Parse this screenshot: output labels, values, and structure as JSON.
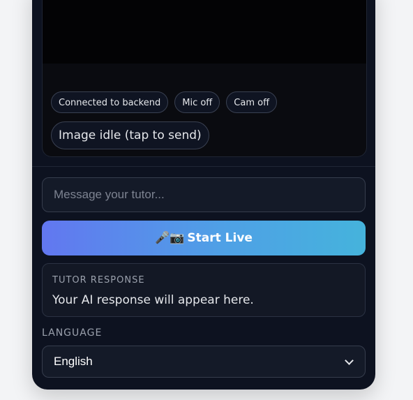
{
  "status_chips": {
    "backend": "Connected to backend",
    "mic": "Mic off",
    "cam": "Cam off",
    "image": "Image idle (tap to send)"
  },
  "message": {
    "placeholder": "Message your tutor...",
    "value": ""
  },
  "start_button": {
    "icons": "🎤📷",
    "label": "Start Live"
  },
  "tutor_response": {
    "title": "TUTOR RESPONSE",
    "text": "Your AI response will appear here."
  },
  "language": {
    "label": "LANGUAGE",
    "selected": "English"
  },
  "colors": {
    "page_background": "#f3f4f6",
    "panel_background": "#0d1220",
    "button_gradient_start": "#6277f0",
    "button_gradient_end": "#45b3dc"
  }
}
